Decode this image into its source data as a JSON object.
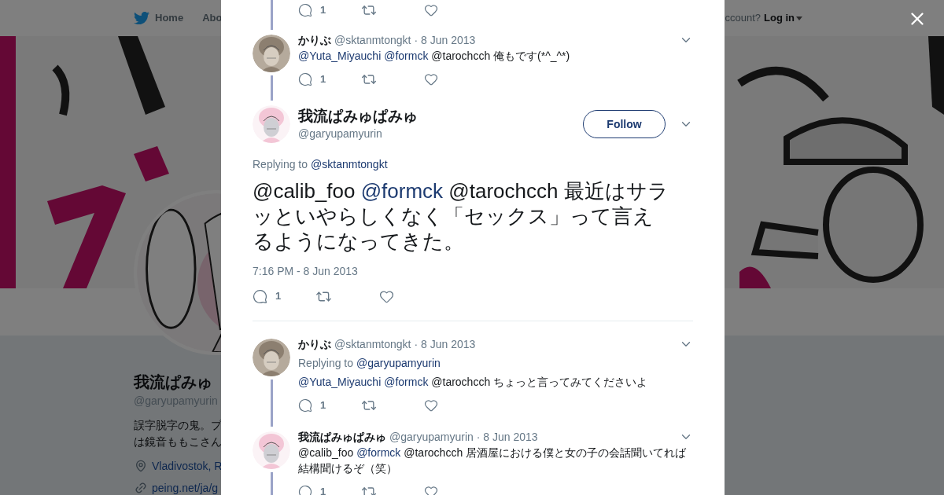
{
  "background": {
    "nav": {
      "home": "Home",
      "about": "Abo",
      "account_prompt": "ccount?",
      "login": "Log in"
    },
    "profile": {
      "name": "我流ぱみゅ",
      "handle": "@garyupamyurin",
      "bio_lines": [
        "誤字脱字の鬼。プ",
        "は鏡音ももこさん"
      ],
      "location": "Vladivostok, R",
      "link": "peing.net/ja/g"
    }
  },
  "thread": [
    {
      "kind": "stub",
      "actions": {
        "replies": "1"
      }
    },
    {
      "kind": "compact",
      "connected": true,
      "name": "かりぶ",
      "handle": "@sktanmtongkt",
      "date": "· 8 Jun 2013",
      "text": [
        {
          "kind": "link",
          "text": "@Yuta_Miyauchi"
        },
        {
          "kind": "link",
          "text": "@formck"
        },
        {
          "kind": "plain",
          "text": "@tarochcch 俺もです(*^_^*)"
        }
      ],
      "actions": {
        "replies": "1"
      }
    },
    {
      "kind": "main",
      "name": "我流ぱみゅぱみゅ",
      "handle": "@garyupamyurin",
      "follow": "Follow",
      "replying_label": "Replying to",
      "replying_to": "@sktanmtongkt",
      "text": [
        {
          "kind": "plain",
          "text": "@calib_foo"
        },
        {
          "kind": "link",
          "text": "@formck"
        },
        {
          "kind": "plain",
          "text": "@tarochcch 最近はサラッといやらしくなく「セックス」って言えるようになってきた。"
        }
      ],
      "time": "7:16 PM - 8 Jun 2013",
      "actions": {
        "replies": "1"
      }
    },
    {
      "kind": "compact",
      "connected": true,
      "name": "かりぶ",
      "handle": "@sktanmtongkt",
      "date": "· 8 Jun 2013",
      "replying_label": "Replying to",
      "replying_to": "@garyupamyurin",
      "text": [
        {
          "kind": "link",
          "text": "@Yuta_Miyauchi"
        },
        {
          "kind": "link",
          "text": "@formck"
        },
        {
          "kind": "plain",
          "text": "@tarochcch ちょっと言ってみてくださいよ"
        }
      ],
      "actions": {
        "replies": "1"
      }
    },
    {
      "kind": "compact",
      "connected": true,
      "name": "我流ぱみゅぱみゅ",
      "handle": "@garyupamyurin",
      "date": "· 8 Jun 2013",
      "text": [
        {
          "kind": "plain",
          "text": "@calib_foo"
        },
        {
          "kind": "link",
          "text": "@formck"
        },
        {
          "kind": "plain",
          "text": "@tarochcch 居酒屋における僕と女の子の会話聞いてれば結構聞けるぞ（笑）"
        }
      ],
      "actions": {
        "replies": "1"
      }
    }
  ]
}
